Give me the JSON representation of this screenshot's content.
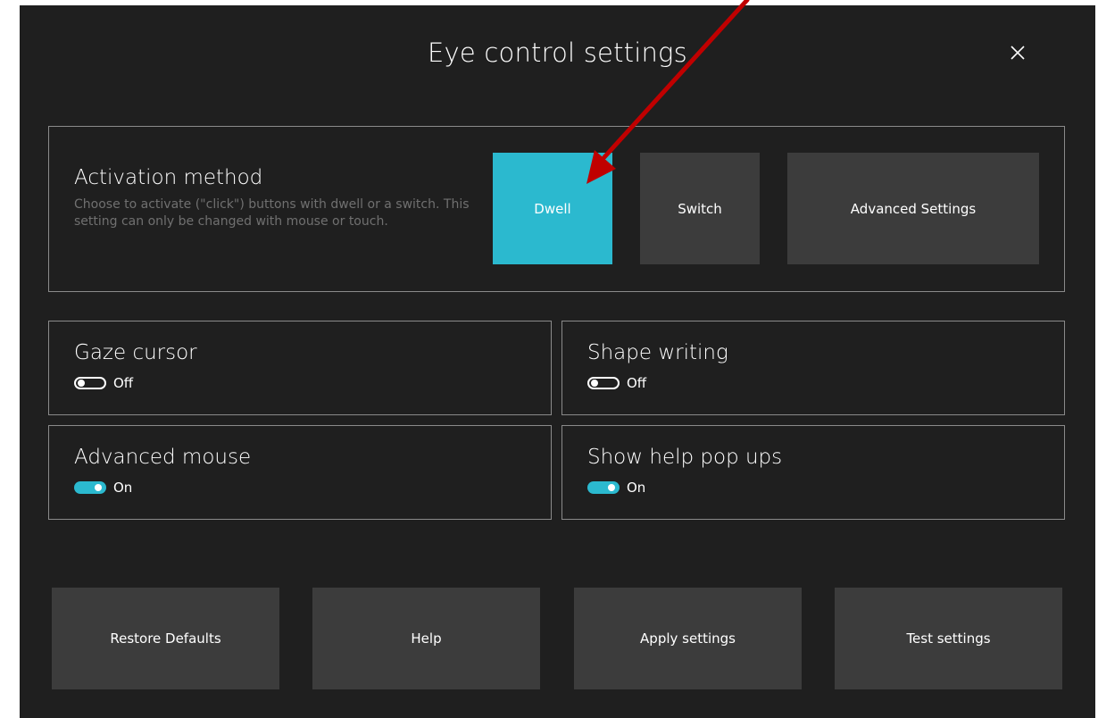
{
  "window": {
    "title": "Eye control settings"
  },
  "activation": {
    "title": "Activation method",
    "description": "Choose to activate (\"click\") buttons with dwell or a switch. This setting can only be changed with mouse or touch.",
    "options": [
      {
        "label": "Dwell",
        "selected": true
      },
      {
        "label": "Switch",
        "selected": false
      },
      {
        "label": "Advanced Settings",
        "selected": false
      }
    ]
  },
  "settings": {
    "gaze_cursor": {
      "label": "Gaze cursor",
      "state": "Off"
    },
    "shape_writing": {
      "label": "Shape writing",
      "state": "Off"
    },
    "advanced_mouse": {
      "label": "Advanced mouse",
      "state": "On"
    },
    "help_popups": {
      "label": "Show help pop ups",
      "state": "On"
    }
  },
  "footer": {
    "restore": "Restore Defaults",
    "help": "Help",
    "apply": "Apply settings",
    "test": "Test settings"
  },
  "colors": {
    "accent": "#2bb9cf",
    "background": "#1f1f1f",
    "button": "#3c3c3c",
    "annotation_arrow": "#c00000"
  },
  "icons": {
    "close": "close-icon",
    "toggle_off": "toggle-off-icon",
    "toggle_on": "toggle-on-icon",
    "annotation": "red-arrow-annotation"
  }
}
